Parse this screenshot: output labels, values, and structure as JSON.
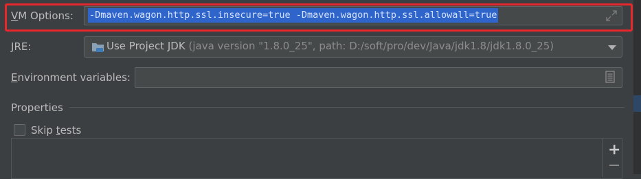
{
  "form": {
    "vm_options": {
      "label_underline": "V",
      "label_rest": "M Options:",
      "value": "-Dmaven.wagon.http.ssl.insecure=true -Dmaven.wagon.http.ssl.allowall=true"
    },
    "jre": {
      "label_underline": "J",
      "label_rest": "RE:",
      "selected_main": "Use Project JDK",
      "selected_detail": "(java version \"1.8.0_25\", path: D:/soft/pro/dev/Java/jdk1.8/jdk1.8.0_25)"
    },
    "env_vars": {
      "label_underline": "E",
      "label_rest": "nvironment variables:",
      "value": ""
    },
    "properties": {
      "header": "Properties",
      "skip_tests_before": "Skip ",
      "skip_tests_underline": "t",
      "skip_tests_after": "ests",
      "skip_tests_checked": false
    }
  },
  "icons": {
    "expand": "expand-icon",
    "folder": "jdk-folder-icon",
    "dropdown": "chevron-down-icon",
    "env_browse": "document-icon",
    "add": "plus-icon",
    "remove": "minus-icon"
  },
  "colors": {
    "highlight_border": "#e8282a",
    "selection": "#2f65ca"
  }
}
